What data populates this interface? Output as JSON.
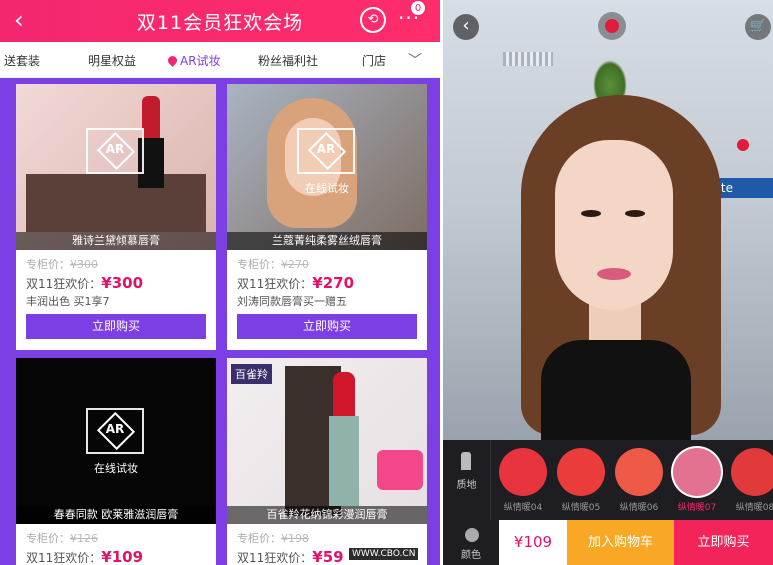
{
  "left_app": {
    "header": {
      "back_icon": "‹",
      "title": "双11会员狂欢会场",
      "share_icon": "⟲",
      "more_icon": "···",
      "badge": "0"
    },
    "categories": [
      {
        "label": "送套装"
      },
      {
        "label": "明星权益"
      },
      {
        "label": "AR试妆",
        "active": true
      },
      {
        "label": "粉丝福利社"
      },
      {
        "label": "门店"
      }
    ],
    "products": [
      {
        "caption": "雅诗兰黛倾慕唇膏",
        "ar_label": "AR",
        "ar_sub": "",
        "orig_label": "专柜价：",
        "orig_price": "¥300",
        "sale_label": "双11狂欢价：",
        "sale_price": "¥300",
        "promo": "丰润出色 买1享7",
        "button": "立即购买"
      },
      {
        "caption": "兰蔻菁纯柔雾丝绒唇膏",
        "ar_label": "AR",
        "ar_sub": "在线试妆",
        "orig_label": "专柜价：",
        "orig_price": "¥270",
        "sale_label": "双11狂欢价：",
        "sale_price": "¥270",
        "promo": "刘涛同款唇膏买一赠五",
        "button": "立即购买"
      },
      {
        "caption": "春春同款 欧莱雅滋润唇膏",
        "ar_label": "AR",
        "ar_sub": "在线试妆",
        "orig_label": "专柜价：",
        "orig_price": "¥126",
        "sale_label": "双11狂欢价：",
        "sale_price": "¥109",
        "promo": "",
        "button": ""
      },
      {
        "caption": "百雀羚花纳锦彩漫润唇膏",
        "ar_label": "",
        "ar_sub": "",
        "orig_label": "专柜价：",
        "orig_price": "¥198",
        "sale_label": "双11狂欢价：",
        "sale_price": "¥59",
        "promo": "",
        "button": ""
      }
    ],
    "corner_tag": "百雀羚",
    "watermark": "WWW.CBO.CN"
  },
  "right_app": {
    "back_icon": "‹",
    "cart_icon": "🛒",
    "sign_text": "kote",
    "swatch_side_label": "质地",
    "swatches": [
      {
        "label": "纵情暖04",
        "color": "#e8343f"
      },
      {
        "label": "纵情暖05",
        "color": "#ea3d3b"
      },
      {
        "label": "纵情暖06",
        "color": "#ee5a45"
      },
      {
        "label": "纵情暖07",
        "color": "#e27290",
        "selected": true
      },
      {
        "label": "纵情暖08",
        "color": "#e23a3a"
      }
    ],
    "bottom_side_label": "颜色",
    "price": "¥109",
    "add_to_cart": "加入购物车",
    "buy_now": "立即购买"
  },
  "colors": {
    "accent_purple": "#7b3fe4",
    "accent_pink": "#f3266f",
    "price_red": "#e1126a",
    "cart_orange": "#f9a825"
  }
}
